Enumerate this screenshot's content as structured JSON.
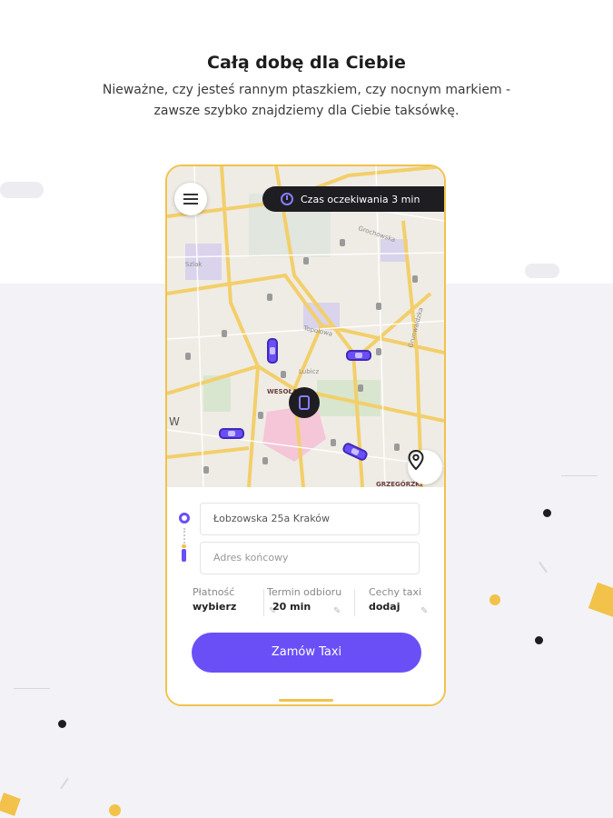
{
  "header": {
    "title": "Całą dobę dla Ciebie",
    "subtitle": "Nieważne, czy jesteś rannym ptaszkiem, czy nocnym markiem - zawsze szybko znajdziemy dla Ciebie taksówkę."
  },
  "map": {
    "wait_time_label": "Czas oczekiwania 3 min",
    "street_labels": [
      "Grochowska",
      "Topolowa",
      "Grunwaldzka",
      "Szlak",
      "Lubicz"
    ],
    "district_labels": [
      "WESOŁA",
      "GRZEGÓRZKI",
      "W"
    ]
  },
  "form": {
    "pickup_value": "Łobzowska 25a Kraków",
    "destination_placeholder": "Adres końcowy",
    "options": [
      {
        "label": "Płatność",
        "value": "wybierz"
      },
      {
        "label": "Termin odbioru",
        "value": "20 min"
      },
      {
        "label": "Cechy taxi",
        "value": "dodaj"
      }
    ],
    "order_button": "Zamów Taxi"
  },
  "colors": {
    "accent": "#6b4ff6",
    "frame": "#f2c24a",
    "dark": "#1e1e22"
  },
  "icons": [
    "menu-icon",
    "clock-icon",
    "location-pin-icon",
    "taxi-icon",
    "edit-icon"
  ]
}
